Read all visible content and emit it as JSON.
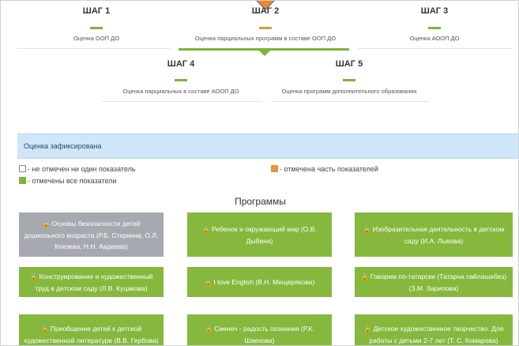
{
  "steps": [
    {
      "title": "ШАГ 1",
      "label": "Оценка ООП ДО",
      "status": "done"
    },
    {
      "title": "ШАГ 2",
      "label": "Оценка парциальных программ в составе ООП ДО",
      "status": "partial"
    },
    {
      "title": "ШАГ 3",
      "label": "Оценка АООП ДО",
      "status": "done"
    },
    {
      "title": "ШАГ 4",
      "label": "Оценка парциальных в составе АООП ДО",
      "status": "done"
    },
    {
      "title": "ШАГ 5",
      "label": "Оценка программ дополнительного образования",
      "status": "done"
    }
  ],
  "alert": {
    "text": "Оценка зафиксирована"
  },
  "legend": {
    "none": "- не отмечен ни один показатель",
    "partial": "- отмечена часть показателей",
    "all": "- отмечены все показатели"
  },
  "programs": {
    "title": "Программы",
    "cards": [
      {
        "text": "Основы безопасности детей дошкольного возраста (Р.Б. Стеркина, О.Л. Князева, Н.Н. Авдеева)",
        "status": "none"
      },
      {
        "text": "Ребенок и окружающий мир (О.В. Дыбина)",
        "status": "all"
      },
      {
        "text": "Изобразительная деятельность в детском саду (И.А. Лыкова)",
        "status": "all"
      },
      {
        "text": "Конструирование и художественный труд в детском саду (Л.В. Куцакова)",
        "status": "all"
      },
      {
        "text": "I love English (В.Н. Мещерякова)",
        "status": "all"
      },
      {
        "text": "Говорим по-татарски (Татарча сөйләшәбез) (З.М. Зарипова)",
        "status": "all"
      },
      {
        "text": "Приобщение детей к детской художественной литературе (В.В. Гербова)",
        "status": "all"
      },
      {
        "text": "Сөенеч - радость познания (Р.К. Шаехова)",
        "status": "all"
      },
      {
        "text": "Детское художественное творчество. Для работы с детьми 2-7 лет (Т. С. Комарова)",
        "status": "all"
      }
    ]
  },
  "colors": {
    "green": "#7ab535",
    "orange": "#e1983d",
    "gray": "#a6aab0",
    "alert_bg": "#cfe6f8"
  },
  "icons": {
    "card_icon": "lock-icon",
    "current_step_marker": "diamond-marker-icon"
  }
}
